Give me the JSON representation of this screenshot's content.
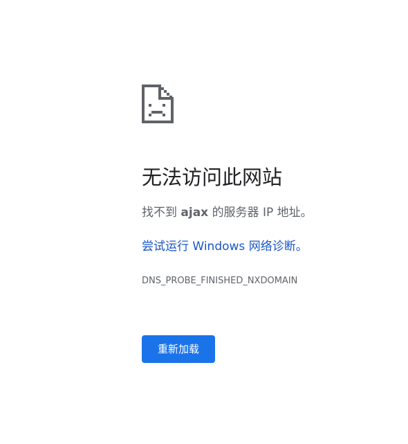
{
  "icon": {
    "name": "sad-page-icon",
    "color": "#5f6368"
  },
  "heading": "无法访问此网站",
  "summary": {
    "prefix": "找不到",
    "host": "ajax",
    "suffix": "的服务器 IP 地址。"
  },
  "suggestion": {
    "label": "尝试运行 Windows 网络诊断。",
    "color": "#1a56c6"
  },
  "error_code": "DNS_PROBE_FINISHED_NXDOMAIN",
  "reload_button": {
    "label": "重新加载",
    "color": "#1a73e8"
  }
}
